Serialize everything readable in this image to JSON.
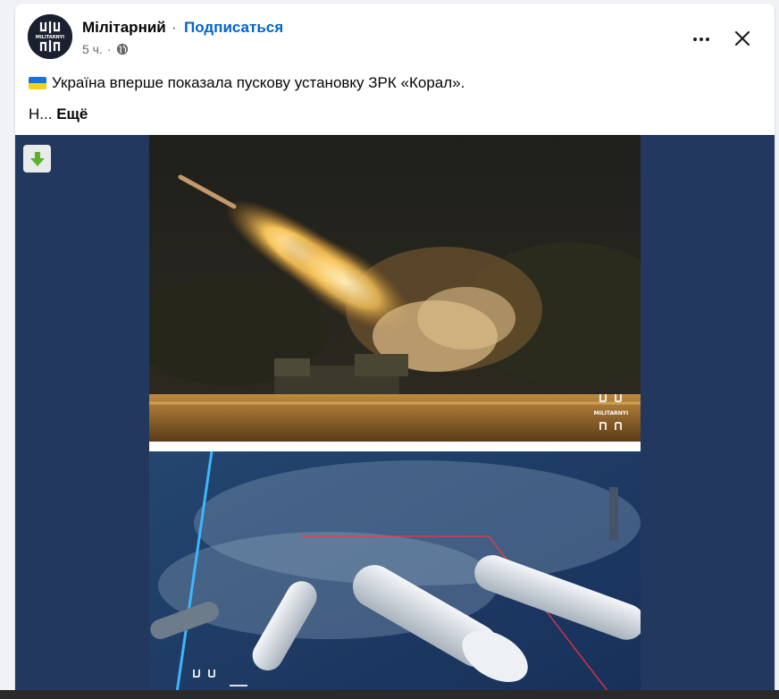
{
  "post": {
    "page_name": "Мілітарний",
    "separator": "·",
    "subscribe_label": "Подписаться",
    "time": "5 ч.",
    "time_separator": "·",
    "privacy_icon": "globe-icon",
    "text_line1": "Україна вперше показала пускову установку ЗРК «Корал».",
    "text_line2_start": "Н...",
    "see_more_label": "Ещё"
  },
  "actions": {
    "more_icon": "more-horizontal-icon",
    "close_icon": "close-icon",
    "download_icon": "download-arrow-icon"
  },
  "media": {
    "watermark_logo": "MILITARNYI"
  },
  "colors": {
    "subscribe": "#0064d1",
    "media_background": "#22385e",
    "flag_blue": "#1f6fd6",
    "flag_yellow": "#f6cf18",
    "download_arrow": "#5db02d"
  }
}
